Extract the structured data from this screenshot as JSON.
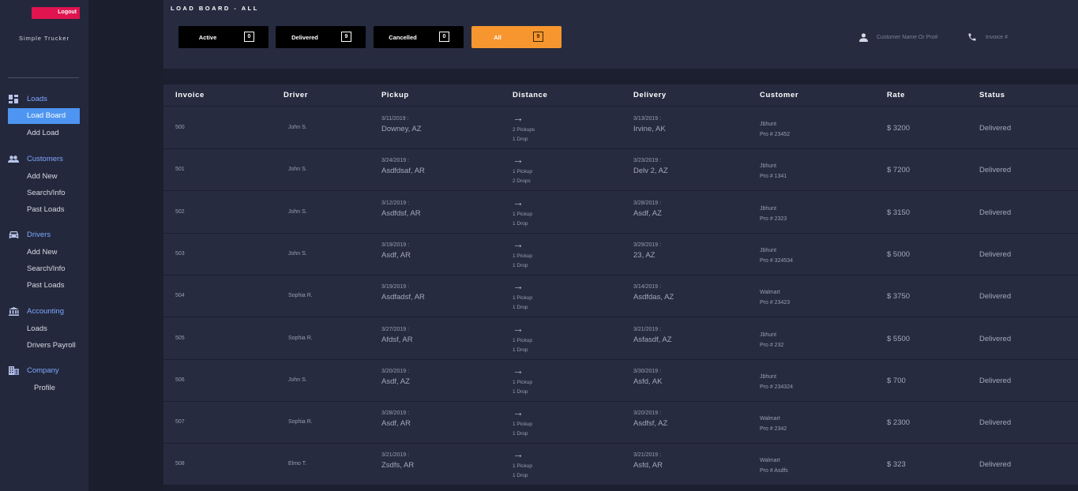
{
  "sidebar": {
    "logout_label": "Logout",
    "brand": "Simple Trucker",
    "sections": [
      {
        "label": "Loads",
        "icon": "dashboard-icon",
        "items": [
          "Load Board",
          "Add Load"
        ]
      },
      {
        "label": "Customers",
        "icon": "people-icon",
        "items": [
          "Add New",
          "Search/Info",
          "Past Loads"
        ]
      },
      {
        "label": "Drivers",
        "icon": "car-icon",
        "items": [
          "Add New",
          "Search/Info",
          "Past Loads"
        ]
      },
      {
        "label": "Accounting",
        "icon": "bank-icon",
        "items": [
          "Loads",
          "Drivers Payroll"
        ]
      },
      {
        "label": "Company",
        "icon": "building-icon",
        "items": [
          "Profile"
        ]
      }
    ],
    "active_item": "Load Board"
  },
  "header": {
    "title": "LOAD BOARD - ALL",
    "filters": [
      {
        "label": "Active",
        "count": "0"
      },
      {
        "label": "Delivered",
        "count": "9"
      },
      {
        "label": "Cancelled",
        "count": "0"
      },
      {
        "label": "All",
        "count": "9"
      }
    ],
    "selected_filter": "All",
    "search_customer_placeholder": "Customer Name Or Pro#",
    "search_invoice_placeholder": "Invoice #"
  },
  "colors": {
    "accent": "#f7962f",
    "active_nav": "#4d95f0",
    "logout": "#e0144f",
    "nav_section": "#7fa8ff"
  },
  "table": {
    "columns": [
      "Invoice",
      "Driver",
      "Pickup",
      "Distance",
      "Delivery",
      "Customer",
      "Rate",
      "Status"
    ],
    "rows": [
      {
        "invoice": "500",
        "driver": "John S.",
        "pickup_date": "3/11/2019 :",
        "pickup_loc": "Downey, AZ",
        "dist1": "2 Pickups",
        "dist2": "1 Drop",
        "delivery_date": "3/13/2019 :",
        "delivery_loc": "Irvine, AK",
        "customer": "Jbhunt",
        "pro": "Pro # 23452",
        "rate": "$ 3200",
        "status": "Delivered"
      },
      {
        "invoice": "501",
        "driver": "John S.",
        "pickup_date": "3/24/2019 :",
        "pickup_loc": "Asdfdsaf, AR",
        "dist1": "1 Pickup",
        "dist2": "2 Drops",
        "delivery_date": "3/23/2019 :",
        "delivery_loc": "Delv 2, AZ",
        "customer": "Jbhunt",
        "pro": "Pro # 1341",
        "rate": "$ 7200",
        "status": "Delivered"
      },
      {
        "invoice": "502",
        "driver": "John S.",
        "pickup_date": "3/12/2019 :",
        "pickup_loc": "Asdfdsf, AR",
        "dist1": "1 Pickup",
        "dist2": "1 Drop",
        "delivery_date": "3/28/2019 :",
        "delivery_loc": "Asdf, AZ",
        "customer": "Jbhunt",
        "pro": "Pro # 2323",
        "rate": "$ 3150",
        "status": "Delivered"
      },
      {
        "invoice": "503",
        "driver": "John S.",
        "pickup_date": "3/19/2019 :",
        "pickup_loc": "Asdf, AR",
        "dist1": "1 Pickup",
        "dist2": "1 Drop",
        "delivery_date": "3/29/2019 :",
        "delivery_loc": "23, AZ",
        "customer": "Jbhunt",
        "pro": "Pro # 324534",
        "rate": "$ 5000",
        "status": "Delivered"
      },
      {
        "invoice": "504",
        "driver": "Sophia R.",
        "pickup_date": "3/19/2019 :",
        "pickup_loc": "Asdfadsf, AR",
        "dist1": "1 Pickup",
        "dist2": "1 Drop",
        "delivery_date": "3/14/2019 :",
        "delivery_loc": "Asdfdas, AZ",
        "customer": "Walmart",
        "pro": "Pro # 23423",
        "rate": "$ 3750",
        "status": "Delivered"
      },
      {
        "invoice": "505",
        "driver": "Sophia R.",
        "pickup_date": "3/27/2019 :",
        "pickup_loc": "Afdsf, AR",
        "dist1": "1 Pickup",
        "dist2": "1 Drop",
        "delivery_date": "3/21/2019 :",
        "delivery_loc": "Asfasdf, AZ",
        "customer": "Jbhunt",
        "pro": "Pro # 232",
        "rate": "$ 5500",
        "status": "Delivered"
      },
      {
        "invoice": "506",
        "driver": "John S.",
        "pickup_date": "3/20/2019 :",
        "pickup_loc": "Asdf, AZ",
        "dist1": "1 Pickup",
        "dist2": "1 Drop",
        "delivery_date": "3/30/2019 :",
        "delivery_loc": "Asfd, AK",
        "customer": "Jbhunt",
        "pro": "Pro # 234324",
        "rate": "$ 700",
        "status": "Delivered"
      },
      {
        "invoice": "507",
        "driver": "Sophia R.",
        "pickup_date": "3/28/2019 :",
        "pickup_loc": "Asdf, AR",
        "dist1": "1 Pickup",
        "dist2": "1 Drop",
        "delivery_date": "3/20/2019 :",
        "delivery_loc": "Asdfsf, AZ",
        "customer": "Walmart",
        "pro": "Pro # 2342",
        "rate": "$ 2300",
        "status": "Delivered"
      },
      {
        "invoice": "508",
        "driver": "Elmo T.",
        "pickup_date": "3/21/2019 :",
        "pickup_loc": "Zsdfs, AR",
        "dist1": "1 Pickup",
        "dist2": "1 Drop",
        "delivery_date": "3/21/2019 :",
        "delivery_loc": "Asfd, AR",
        "customer": "Walmart",
        "pro": "Pro # Asdfs",
        "rate": "$ 323",
        "status": "Delivered"
      }
    ]
  }
}
